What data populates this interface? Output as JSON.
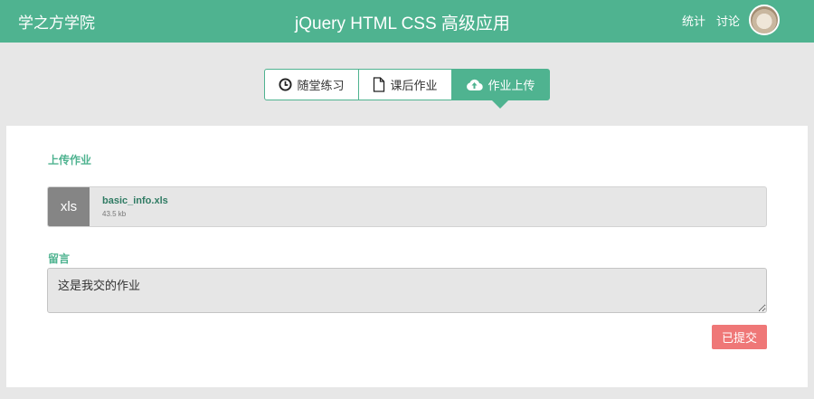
{
  "header": {
    "brand": "学之方学院",
    "title": "jQuery HTML CSS 高级应用",
    "nav": [
      "统计",
      "讨论"
    ]
  },
  "tabs": [
    {
      "label": "随堂练习",
      "icon": "clock-icon",
      "active": false
    },
    {
      "label": "课后作业",
      "icon": "document-icon",
      "active": false
    },
    {
      "label": "作业上传",
      "icon": "cloud-upload-icon",
      "active": true
    }
  ],
  "upload": {
    "section_label": "上传作业",
    "file": {
      "type": "xls",
      "name": "basic_info.xls",
      "size": "43.5 kb"
    }
  },
  "comment": {
    "section_label": "留言",
    "value": "这是我交的作业"
  },
  "submit_label": "已提交",
  "colors": {
    "accent": "#4fb390",
    "submitted": "#ef7777",
    "background": "#e7e7e7"
  }
}
